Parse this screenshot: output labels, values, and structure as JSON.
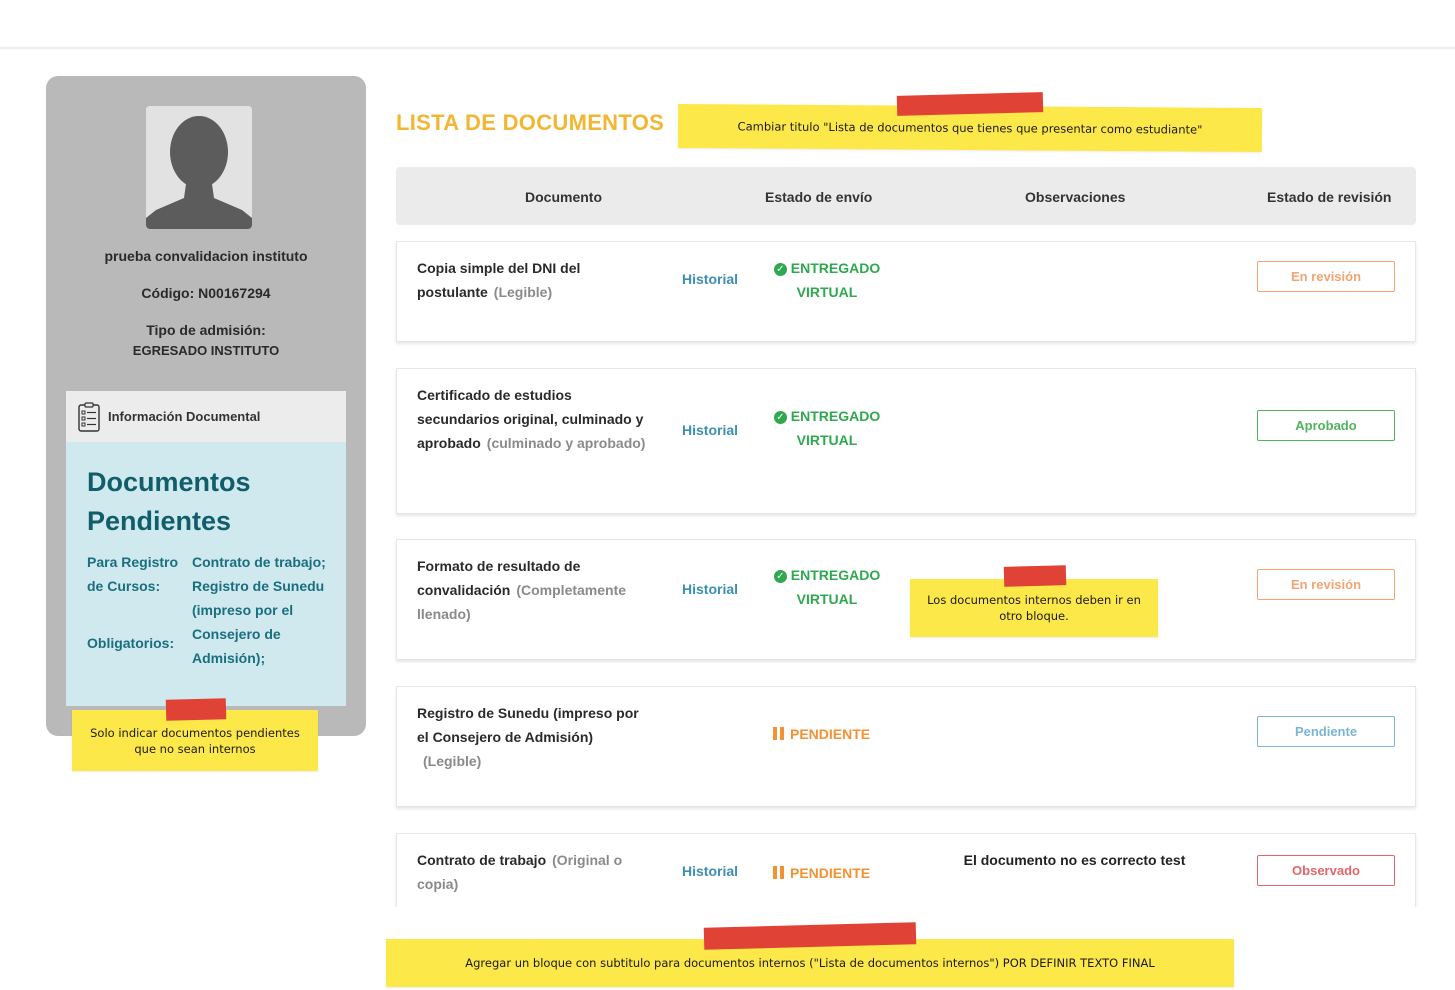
{
  "profile": {
    "name": "prueba convalidacion instituto",
    "code": "Código: N00167294",
    "admission_label": "Tipo de admisión:",
    "admission_value": "EGRESADO INSTITUTO"
  },
  "info_panel": {
    "header": "Información Documental",
    "title": "Documentos Pendientes",
    "label_registro": "Para Registro de Cursos:",
    "label_obligatorios": "Obligatorios:",
    "values": "Contrato de trabajo; Registro de Sunedu (impreso por el Consejero de Admisión);"
  },
  "main": {
    "title": "LISTA DE DOCUMENTOS"
  },
  "table": {
    "headers": [
      "Documento",
      "Estado de envío",
      "Observaciones",
      "Estado de revisión"
    ],
    "rows": [
      {
        "document": "Copia simple del DNI del postulante",
        "note": "(Legible)",
        "history": "Historial",
        "status": "ENTREGADO VIRTUAL",
        "observation": "",
        "review": "En revisión"
      },
      {
        "document": "Certificado de estudios secundarios original, culminado y aprobado",
        "note": "(culminado y aprobado)",
        "history": "Historial",
        "status": "ENTREGADO VIRTUAL",
        "observation": "",
        "review": "Aprobado"
      },
      {
        "document": "Formato de resultado de convalidación",
        "note": "(Completamente llenado)",
        "history": "Historial",
        "status": "ENTREGADO VIRTUAL",
        "observation": "",
        "review": "En revisión"
      },
      {
        "document": "Registro de Sunedu (impreso por el Consejero de Admisión)",
        "note": "(Legible)",
        "history": "",
        "status": "PENDIENTE",
        "observation": "",
        "review": "Pendiente"
      },
      {
        "document": "Contrato de trabajo",
        "note": "(Original o copia)",
        "history": "Historial",
        "status": "PENDIENTE",
        "observation": "El documento no es correcto test",
        "review": "Observado"
      }
    ]
  },
  "sticky_notes": {
    "title_note": "Cambiar titulo  \"Lista de documentos que tienes que presentar como estudiante\"",
    "internal_note": "Los documentos internos deben ir en otro bloque.",
    "sidebar_note": "Solo indicar documentos pendientes que no sean internos",
    "bottom_note": "Agregar un bloque con subtitulo para documentos internos (\"Lista de documentos internos\") POR DEFINIR TEXTO FINAL"
  },
  "colors": {
    "title": "#f2b632",
    "teal": "#125d6a",
    "link": "#3b8fb3",
    "delivered": "#2fa84f",
    "pending": "#f39233",
    "sticky": "#fde84a",
    "tape": "#e04236"
  }
}
